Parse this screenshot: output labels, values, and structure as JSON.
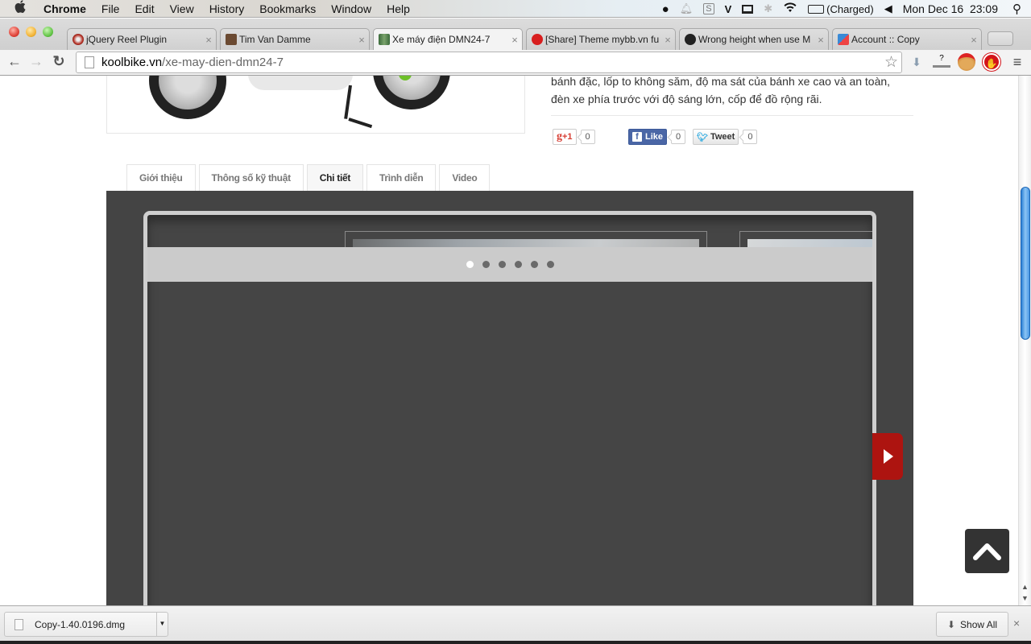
{
  "menubar": {
    "apple": "",
    "items": [
      "Chrome",
      "File",
      "Edit",
      "View",
      "History",
      "Bookmarks",
      "Window",
      "Help"
    ],
    "battery": "(Charged)",
    "clock": "Mon Dec 16  23:09",
    "tray_icons": [
      "notification-drop-icon",
      "bell-icon",
      "s-shield-icon",
      "v-icon",
      "display-icon",
      "bluetooth-icon",
      "wifi-icon",
      "battery-icon",
      "volume-icon",
      "spotlight-icon"
    ]
  },
  "browser": {
    "tabs": [
      {
        "title": "jQuery Reel Plugin",
        "favicon_color": "#b22a1e",
        "active": false
      },
      {
        "title": "Tim Van Damme",
        "favicon_color": "#6b4a32",
        "active": false
      },
      {
        "title": "Xe máy điện DMN24-7",
        "favicon_color": "#4f7a4a",
        "active": true
      },
      {
        "title": "[Share] Theme mybb.vn fu",
        "favicon_color": "#d81e1e",
        "active": false
      },
      {
        "title": "Wrong height when use M",
        "favicon_color": "#222222",
        "active": false
      },
      {
        "title": "Account :: Copy",
        "favicon_color": "#3a8ad6",
        "active": false
      }
    ],
    "url_host": "koolbike.vn",
    "url_path": "/xe-may-dien-dmn24-7",
    "back": "←",
    "forward": "→",
    "reload": "↻",
    "bookmark_star": "☆"
  },
  "page": {
    "description_lines": [
      "bánh đặc, lốp to không săm, độ ma sát của bánh xe cao và an toàn,",
      "đèn xe phía trước với độ sáng lớn, cốp để đồ rộng rãi."
    ],
    "share": {
      "gplus_label": "+1",
      "gplus_count": "0",
      "like_label": "Like",
      "like_count": "0",
      "tweet_label": "Tweet",
      "tweet_count": "0"
    },
    "tabs": [
      {
        "label": "Giới thiệu",
        "active": false
      },
      {
        "label": "Thông số kỹ thuật",
        "active": false
      },
      {
        "label": "Chi tiết",
        "active": true
      },
      {
        "label": "Trình diễn",
        "active": false
      },
      {
        "label": "Video",
        "active": false
      }
    ],
    "carousel": {
      "slide_count": 6,
      "active_index": 0
    }
  },
  "download_shelf": {
    "file_name": "Copy-1.40.0196.dmg",
    "show_all": "Show All",
    "close": "×"
  },
  "colors": {
    "panel_bg": "#444444",
    "accent_red": "#ad1410",
    "dots_bar": "#cbcbcb"
  }
}
